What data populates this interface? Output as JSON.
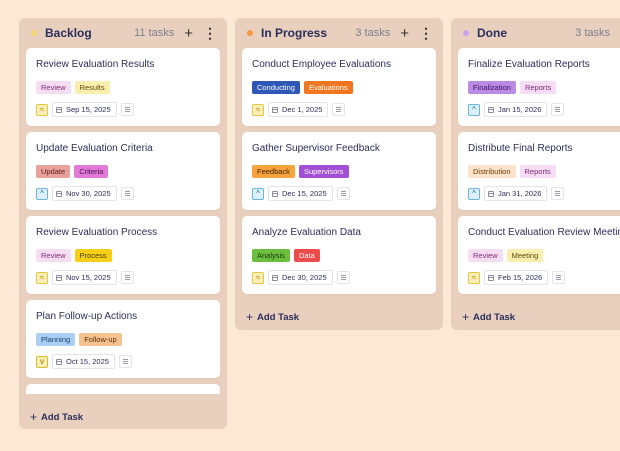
{
  "colors": {
    "page_bg": "#fde8d6",
    "column_bg": "#e9cfbd"
  },
  "add_task_label": "Add Task",
  "columns": [
    {
      "title": "Backlog",
      "count": "11 tasks",
      "dot_color": "#f4d675",
      "cards": [
        {
          "title": "Review Evaluation Results",
          "tags": [
            {
              "label": "Review",
              "bg": "#f6dcf4",
              "fg": "#7a2e73"
            },
            {
              "label": "Results",
              "bg": "#fbefb0",
              "fg": "#5c4b00"
            }
          ],
          "priority": "high",
          "date": "Sep 15, 2025"
        },
        {
          "title": "Update Evaluation Criteria",
          "tags": [
            {
              "label": "Update",
              "bg": "#e9a19b",
              "fg": "#5a1d18"
            },
            {
              "label": "Criteria",
              "bg": "#e27ad8",
              "fg": "#4a0f44"
            }
          ],
          "priority": "medium",
          "date": "Nov 30, 2025"
        },
        {
          "title": "Review Evaluation Process",
          "tags": [
            {
              "label": "Review",
              "bg": "#f6dcf4",
              "fg": "#7a2e73"
            },
            {
              "label": "Process",
              "bg": "#f7cf16",
              "fg": "#4a3a00"
            }
          ],
          "priority": "high",
          "date": "Nov 15, 2025"
        },
        {
          "title": "Plan Follow-up Actions",
          "tags": [
            {
              "label": "Planning",
              "bg": "#a9cff5",
              "fg": "#17406a"
            },
            {
              "label": "Follow-up",
              "bg": "#f6c28f",
              "fg": "#5a3006"
            }
          ],
          "priority": "low",
          "date": "Oct 15, 2025"
        }
      ],
      "has_stub": true
    },
    {
      "title": "In Progress",
      "count": "3 tasks",
      "dot_color": "#f39a3c",
      "cards": [
        {
          "title": "Conduct Employee Evaluations",
          "tags": [
            {
              "label": "Conducting",
              "bg": "#2e57b6",
              "fg": "#ffffff"
            },
            {
              "label": "Evaluations",
              "bg": "#f0761f",
              "fg": "#ffffff"
            }
          ],
          "priority": "high",
          "date": "Dec 1, 2025"
        },
        {
          "title": "Gather Supervisor Feedback",
          "tags": [
            {
              "label": "Feedback",
              "bg": "#f7a43c",
              "fg": "#3f2300"
            },
            {
              "label": "Supervisors",
              "bg": "#a04fd6",
              "fg": "#ffffff"
            }
          ],
          "priority": "medium",
          "date": "Dec 15, 2025"
        },
        {
          "title": "Analyze Evaluation Data",
          "tags": [
            {
              "label": "Analysis",
              "bg": "#6cbe3e",
              "fg": "#163a05"
            },
            {
              "label": "Data",
              "bg": "#ea4b4b",
              "fg": "#ffffff"
            }
          ],
          "priority": "high",
          "date": "Dec 30, 2025"
        }
      ],
      "has_stub": false
    },
    {
      "title": "Done",
      "count": "3 tasks",
      "dot_color": "#c9a2ee",
      "cards": [
        {
          "title": "Finalize Evaluation Reports",
          "tags": [
            {
              "label": "Finalization",
              "bg": "#b98be3",
              "fg": "#3a1160"
            },
            {
              "label": "Reports",
              "bg": "#f6dcf4",
              "fg": "#7a2e73"
            }
          ],
          "priority": "medium",
          "date": "Jan 15, 2026"
        },
        {
          "title": "Distribute Final Reports",
          "tags": [
            {
              "label": "Distribution",
              "bg": "#fde3c9",
              "fg": "#6a3b0a"
            },
            {
              "label": "Reports",
              "bg": "#f6dcf4",
              "fg": "#7a2e73"
            }
          ],
          "priority": "medium",
          "date": "Jan 31, 2026"
        },
        {
          "title": "Conduct Evaluation Review Meeting",
          "tags": [
            {
              "label": "Review",
              "bg": "#f6dcf4",
              "fg": "#7a2e73"
            },
            {
              "label": "Meeting",
              "bg": "#fbefb0",
              "fg": "#5c4b00"
            }
          ],
          "priority": "high",
          "date": "Feb 15, 2026"
        }
      ],
      "has_stub": false
    }
  ],
  "priority_icons": {
    "high": {
      "glyph": "≈",
      "name": "double-chevron-up-icon",
      "bg": "#fbeeb5",
      "border": "#e3c54a",
      "fg": "#b08200"
    },
    "medium": {
      "glyph": "^",
      "name": "chevron-up-icon",
      "bg": "#dcf0fb",
      "border": "#6bb4dd",
      "fg": "#1f6f9c"
    },
    "low": {
      "glyph": "v",
      "name": "chevron-down-icon",
      "bg": "#fbf0b3",
      "border": "#d9bc33",
      "fg": "#8f6f00"
    }
  }
}
